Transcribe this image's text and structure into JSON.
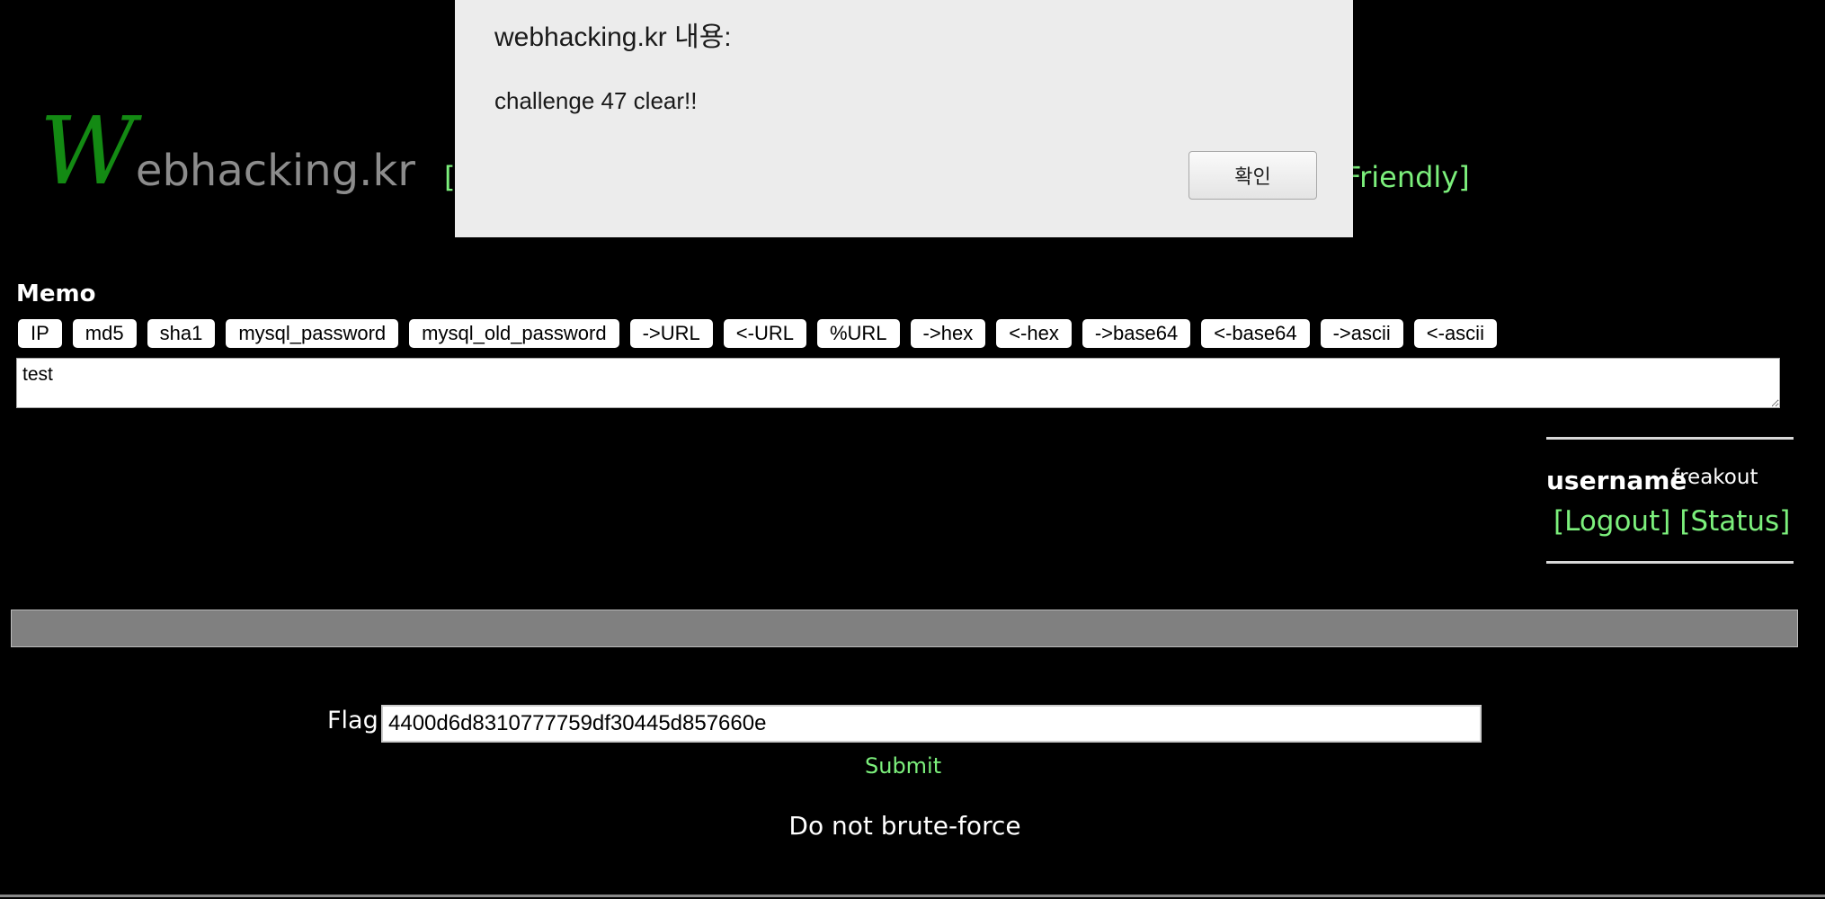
{
  "logo": {
    "first_letter": "W",
    "rest": "ebhacking.kr"
  },
  "header_nav": {
    "left_fragment": "[",
    "right_fragment": "Friendly]"
  },
  "memo": {
    "label": "Memo",
    "buttons": [
      "IP",
      "md5",
      "sha1",
      "mysql_password",
      "mysql_old_password",
      "->URL",
      "<-URL",
      "%URL",
      "->hex",
      "<-hex",
      "->base64",
      "<-base64",
      "->ascii",
      "<-ascii"
    ],
    "value": "test"
  },
  "user": {
    "label": "username",
    "value": "freakout",
    "logout": "[Logout]",
    "status": "[Status]"
  },
  "flag": {
    "label": "Flag",
    "value": "4400d6d8310777759df30445d857660e",
    "submit": "Submit",
    "notice": "Do not brute-force"
  },
  "dialog": {
    "title": "webhacking.kr 내용:",
    "message": "challenge 47 clear!!",
    "ok_label": "확인"
  },
  "colors": {
    "background": "#000000",
    "link_green": "#7cf07c",
    "logo_green": "#138a13",
    "logo_grey": "#8c8c8c",
    "bar_grey": "#808080",
    "dialog_bg": "#ececec"
  }
}
